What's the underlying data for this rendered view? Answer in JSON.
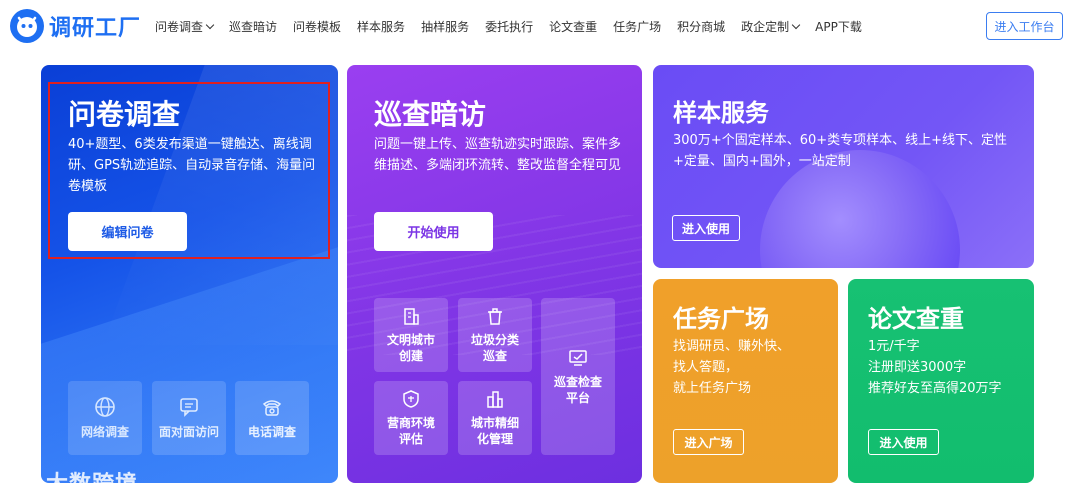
{
  "header": {
    "logo_text": "调研工厂",
    "nav": [
      {
        "label": "问卷调查",
        "dropdown": true
      },
      {
        "label": "巡查暗访",
        "dropdown": false
      },
      {
        "label": "问卷模板",
        "dropdown": false
      },
      {
        "label": "样本服务",
        "dropdown": false
      },
      {
        "label": "抽样服务",
        "dropdown": false
      },
      {
        "label": "委托执行",
        "dropdown": false
      },
      {
        "label": "论文查重",
        "dropdown": false
      },
      {
        "label": "任务广场",
        "dropdown": false
      },
      {
        "label": "积分商城",
        "dropdown": false
      },
      {
        "label": "政企定制",
        "dropdown": true
      },
      {
        "label": "APP下载",
        "dropdown": false
      }
    ],
    "workspace_button": "进入工作台"
  },
  "survey": {
    "title": "问卷调查",
    "desc": "40+题型、6类发布渠道一键触达、离线调研、GPS轨迹追踪、自动录音存储、海量问卷模板",
    "button": "编辑问卷",
    "tiles": [
      "网络调查",
      "面对面访问",
      "电话调查"
    ]
  },
  "patrol": {
    "title": "巡查暗访",
    "desc": "问题一键上传、巡查轨迹实时跟踪、案件多维描述、多端闭环流转、整改监督全程可见",
    "button": "开始使用",
    "tiles": [
      "文明城市创建",
      "垃圾分类巡查",
      "巡查检查平台",
      "营商环境评估",
      "城市精细化管理"
    ]
  },
  "sample": {
    "title": "样本服务",
    "desc": "300万+个固定样本、60+类专项样本、线上+线下、定性+定量、国内+国外，一站定制",
    "button": "进入使用"
  },
  "task": {
    "title": "任务广场",
    "lines": [
      "找调研员、赚外快、",
      "找人答题，",
      "就上任务广场"
    ],
    "button": "进入广场"
  },
  "paper": {
    "title": "论文查重",
    "lines": [
      "1元/千字",
      "注册即送3000字",
      "推荐好友至高得20万字"
    ],
    "button": "进入使用"
  },
  "watermark": "大数跨境",
  "colors": {
    "brand": "#1e6ff2",
    "survey_button_text": "#1e5be6",
    "patrol_button_text": "#7b35e5",
    "highlight": "#e02020"
  }
}
